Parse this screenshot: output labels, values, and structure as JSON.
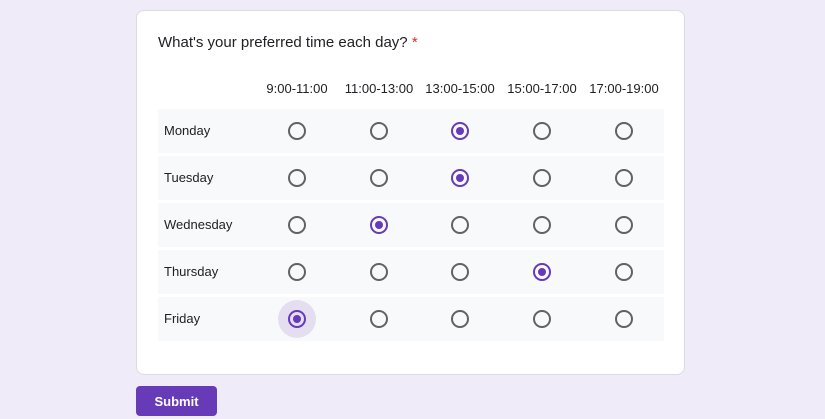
{
  "question": {
    "title": "What's your preferred time each day?",
    "required_mark": "*"
  },
  "columns": [
    "9:00-11:00",
    "11:00-13:00",
    "13:00-15:00",
    "15:00-17:00",
    "17:00-19:00"
  ],
  "rows": [
    {
      "label": "Monday",
      "selected": 2
    },
    {
      "label": "Tuesday",
      "selected": 2
    },
    {
      "label": "Wednesday",
      "selected": 1
    },
    {
      "label": "Thursday",
      "selected": 3
    },
    {
      "label": "Friday",
      "selected": 0,
      "focused": true
    }
  ],
  "submit_label": "Submit",
  "accent": "#673ab7"
}
